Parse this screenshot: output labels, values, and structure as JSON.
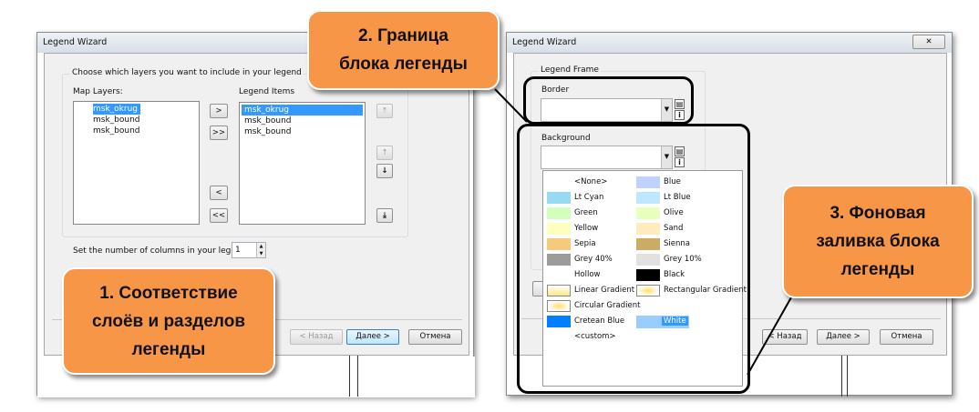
{
  "left_dialog": {
    "title": "Legend Wizard",
    "group_label": "Choose which layers you want to include in your legend",
    "map_layers_label": "Map Layers:",
    "map_layers": [
      "msk_okrug",
      "msk_bound",
      "msk_bound"
    ],
    "legend_items_label": "Legend Items",
    "legend_items": [
      "msk_okrug",
      "msk_bound",
      "msk_bound"
    ],
    "add_label": ">",
    "add_all_label": ">>",
    "remove_label": "<",
    "remove_all_label": "<<",
    "columns_label": "Set the number of columns in your legend:",
    "columns_value": "1",
    "back_label": "< Назад",
    "next_label": "Далее >",
    "cancel_label": "Отмена"
  },
  "right_dialog": {
    "title": "Legend Wizard",
    "close_label": "✕",
    "group_label": "Legend Frame",
    "border_label": "Border",
    "background_label": "Background",
    "colors": [
      {
        "name": "<None>",
        "color": ""
      },
      {
        "name": "Blue",
        "color": "#bed2ff"
      },
      {
        "name": "Lt Cyan",
        "color": "#97dbf2"
      },
      {
        "name": "Lt Blue",
        "color": "#bee8ff"
      },
      {
        "name": "Green",
        "color": "#d3ffbe"
      },
      {
        "name": "Olive",
        "color": "#e9ffbe"
      },
      {
        "name": "Yellow",
        "color": "#ffffbe"
      },
      {
        "name": "Sand",
        "color": "#ffebbe"
      },
      {
        "name": "Sepia",
        "color": "#f5ca7a"
      },
      {
        "name": "Sienna",
        "color": "#cdaa66"
      },
      {
        "name": "Grey 40%",
        "color": "#9c9c9c"
      },
      {
        "name": "Grey 10%",
        "color": "#e1e1e1"
      },
      {
        "name": "Hollow",
        "color": ""
      },
      {
        "name": "Black",
        "color": "#000000"
      },
      {
        "name": "Linear Gradient",
        "color": "linear-gradient(#fff,#ffe680)"
      },
      {
        "name": "Rectangular Gradient",
        "color": "radial-gradient(#ffe066,#fff 70%)"
      },
      {
        "name": "Circular Gradient",
        "color": "radial-gradient(#ffe066,#fff 70%)"
      },
      {
        "name": "",
        "color": ""
      },
      {
        "name": "Cretean Blue",
        "color": "#0080ff"
      },
      {
        "name": "White",
        "color": "#99ccff"
      },
      {
        "name": "<custom>",
        "color": ""
      }
    ],
    "back_label": "< Назад",
    "next_label": "Далее >",
    "cancel_label": "Отмена"
  },
  "callouts": {
    "one": [
      "1. Соответствие",
      "слоёв и разделов",
      "легенды"
    ],
    "two": [
      "2. Граница",
      "блока легенды"
    ],
    "three": [
      "3. Фоновая",
      "заливка блока",
      "легенды"
    ]
  },
  "accent": "#f79646"
}
